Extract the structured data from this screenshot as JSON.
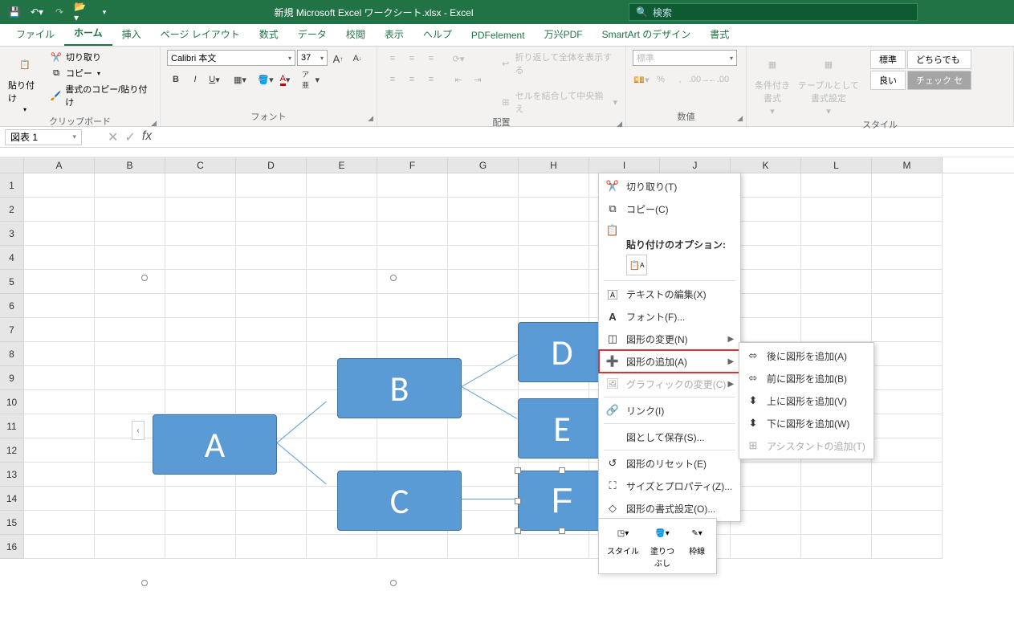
{
  "titlebar": {
    "title": "新規 Microsoft Excel ワークシート.xlsx  -  Excel",
    "search_placeholder": "検索"
  },
  "ribbon_tabs": [
    "ファイル",
    "ホーム",
    "挿入",
    "ページ レイアウト",
    "数式",
    "データ",
    "校閲",
    "表示",
    "ヘルプ",
    "PDFelement",
    "万兴PDF",
    "SmartArt のデザイン",
    "書式"
  ],
  "ribbon": {
    "clipboard": {
      "paste": "貼り付け",
      "cut": "切り取り",
      "copy": "コピー",
      "format_painter": "書式のコピー/貼り付け",
      "group_label": "クリップボード"
    },
    "font": {
      "font_name": "Calibri 本文",
      "font_size": "37",
      "group_label": "フォント"
    },
    "alignment": {
      "wrap": "折り返して全体を表示する",
      "merge": "セルを結合して中央揃え",
      "group_label": "配置"
    },
    "number": {
      "format": "標準",
      "group_label": "数値"
    },
    "styles": {
      "conditional": "条件付き\n書式",
      "table_format": "テーブルとして\n書式設定",
      "gallery_normal": "標準",
      "gallery_neutral": "どちらでも",
      "gallery_good": "良い",
      "gallery_check": "チェック セ",
      "group_label": "スタイル"
    }
  },
  "name_box": "図表 1",
  "columns": [
    "A",
    "B",
    "C",
    "D",
    "E",
    "F",
    "G",
    "H",
    "I",
    "J",
    "K",
    "L",
    "M"
  ],
  "rows": [
    "1",
    "2",
    "3",
    "4",
    "5",
    "6",
    "7",
    "8",
    "9",
    "10",
    "11",
    "12",
    "13",
    "14",
    "15",
    "16"
  ],
  "smartart": {
    "nodes": {
      "a": "A",
      "b": "B",
      "c": "C",
      "d": "D",
      "e": "E",
      "f": "F"
    }
  },
  "context_menu": {
    "cut": "切り取り(T)",
    "copy": "コピー(C)",
    "paste_options_label": "貼り付けのオプション:",
    "edit_text": "テキストの編集(X)",
    "font": "フォント(F)...",
    "change_shape": "図形の変更(N)",
    "add_shape": "図形の追加(A)",
    "change_graphic": "グラフィックの変更(C)",
    "link": "リンク(I)",
    "save_as_picture": "図として保存(S)...",
    "reset_shape": "図形のリセット(E)",
    "size_properties": "サイズとプロパティ(Z)...",
    "format_shape": "図形の書式設定(O)..."
  },
  "submenu": {
    "add_after": "後に図形を追加(A)",
    "add_before": "前に図形を追加(B)",
    "add_above": "上に図形を追加(V)",
    "add_below": "下に図形を追加(W)",
    "add_assistant": "アシスタントの追加(T)"
  },
  "mini_toolbar": {
    "style": "スタイル",
    "fill": "塗りつ\nぶし",
    "outline": "枠線"
  }
}
